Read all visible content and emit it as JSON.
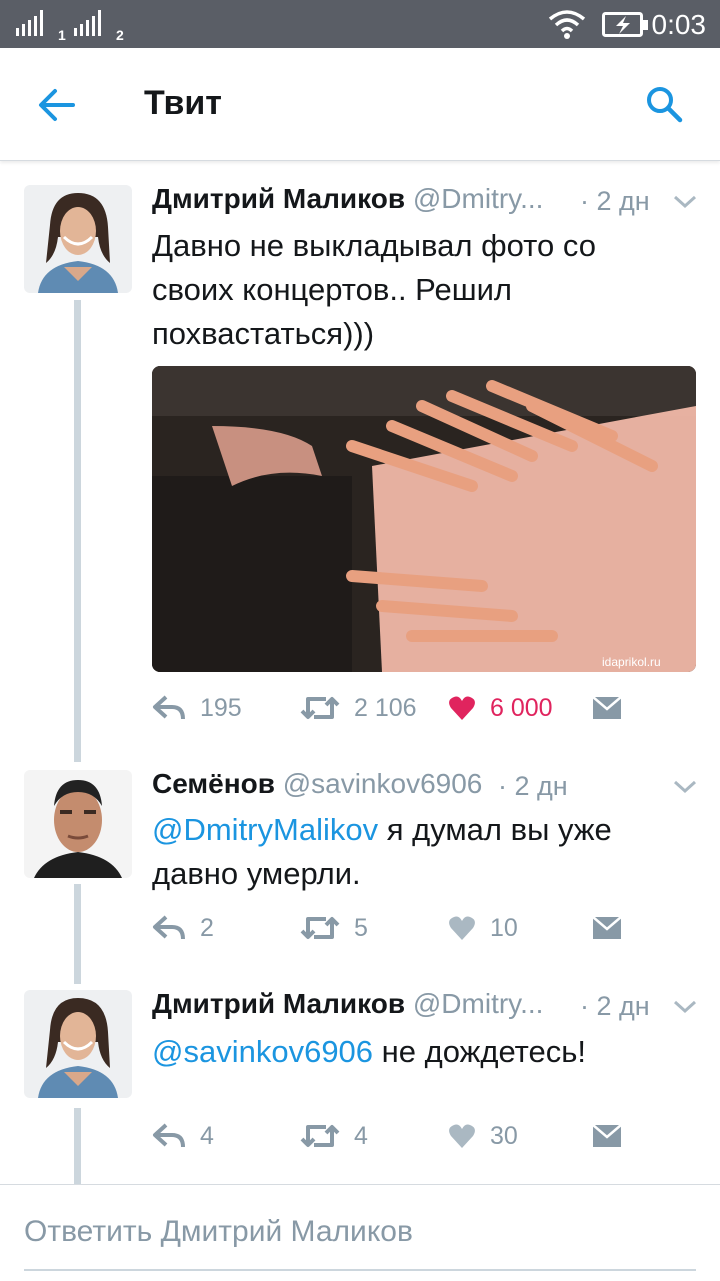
{
  "status_bar": {
    "sim1": "1",
    "sim2": "2",
    "time": "0:03"
  },
  "header": {
    "title": "Твит"
  },
  "tweets": [
    {
      "name": "Дмитрий Маликов",
      "handle": "@Dmitry...",
      "time": "· 2 дн",
      "text_lines": [
        "Давно не выкладывал фото со",
        "своих концертов.. Решил",
        "похвастаться)))"
      ],
      "photo_watermark": "idaprikol.ru",
      "replies": "195",
      "retweets": "2 106",
      "likes": "6 000",
      "liked": true
    },
    {
      "name": "Семёнов",
      "handle": "@savinkov6906",
      "time": "· 2 дн",
      "mention": "@DmitryMalikov",
      "text_after_mention": " я думал вы уже",
      "text_line2": "давно умерли.",
      "replies": "2",
      "retweets": "5",
      "likes": "10"
    },
    {
      "name": "Дмитрий Маликов",
      "handle": "@Dmitry...",
      "time": "· 2 дн",
      "mention": "@savinkov6906",
      "text_after_mention": " не дождетесь!",
      "replies": "4",
      "retweets": "4",
      "likes": "30"
    }
  ],
  "reply_box": {
    "placeholder": "Ответить Дмитрий Маликов"
  },
  "colors": {
    "accent": "#1b95e0",
    "like": "#e0245e",
    "muted": "#8899a6"
  }
}
